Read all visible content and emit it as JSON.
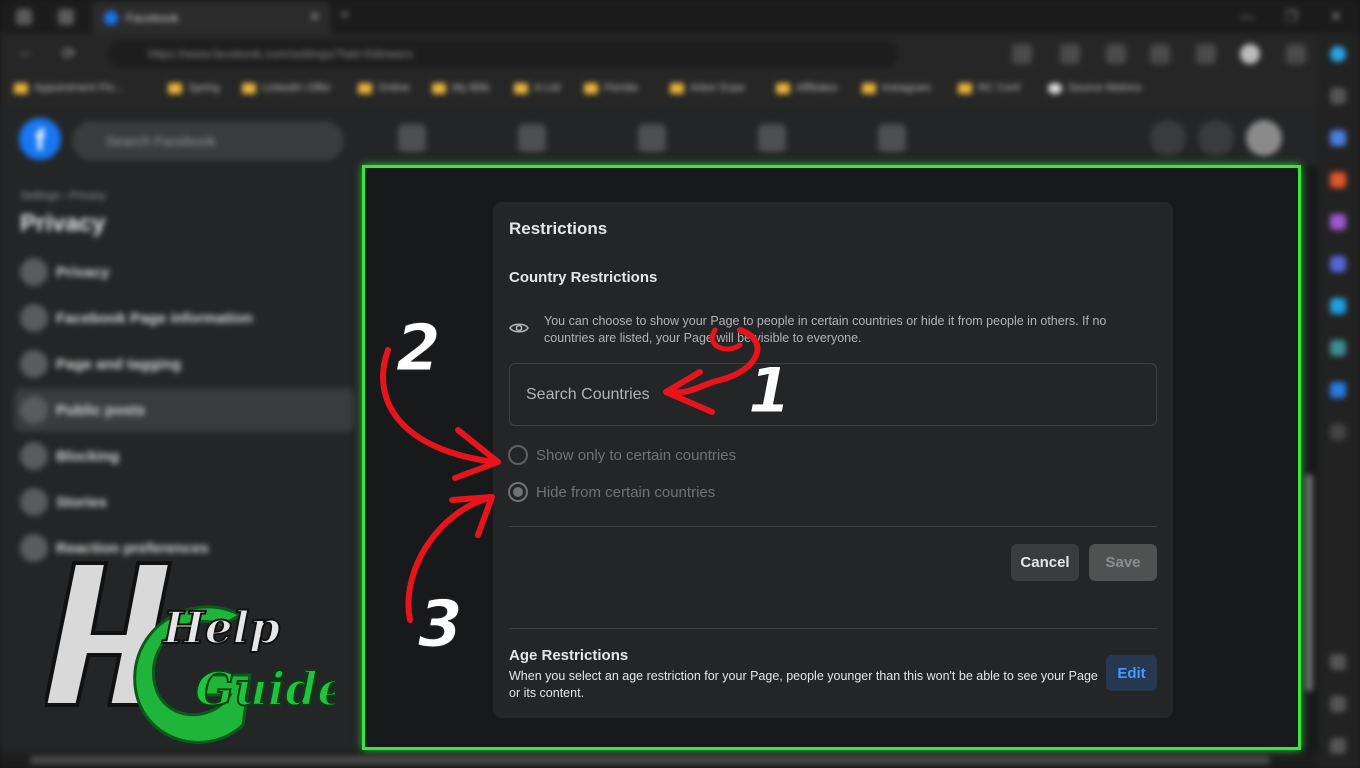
{
  "browser": {
    "tab_title": "Facebook",
    "url": "https://www.facebook.com/settings/?tab=followers",
    "bookmarks": [
      "Appointment Fin...",
      "Spring",
      "LinkedIn Offer",
      "Online",
      "My Bills",
      "A-Ltd",
      "Florida",
      "Arbor Expo",
      "Affiliates",
      "Instagram",
      "RC Conf",
      "Source Metrics"
    ]
  },
  "facebook": {
    "search_placeholder": "Search Facebook",
    "breadcrumb": "Settings › Privacy",
    "sidebar_title": "Privacy",
    "sidebar_items": [
      {
        "label": "Privacy"
      },
      {
        "label": "Facebook Page information"
      },
      {
        "label": "Page and tagging"
      },
      {
        "label": "Public posts"
      },
      {
        "label": "Blocking"
      },
      {
        "label": "Stories"
      },
      {
        "label": "Reaction preferences"
      }
    ]
  },
  "restrictions": {
    "title": "Restrictions",
    "country": {
      "title": "Country Restrictions",
      "info": "You can choose to show your Page to people in certain countries or hide it from people in others. If no countries are listed, your Page will be visible to everyone.",
      "search_placeholder": "Search Countries",
      "options": [
        {
          "label": "Show only to certain countries",
          "checked": false
        },
        {
          "label": "Hide from certain countries",
          "checked": true
        }
      ],
      "cancel_label": "Cancel",
      "save_label": "Save"
    },
    "age": {
      "title": "Age Restrictions",
      "text": "When you select an age restriction for your Page, people younger than this won't be able to see your Page or its content.",
      "edit_label": "Edit"
    }
  },
  "annotations": {
    "step1": "1",
    "step2": "2",
    "step3": "3",
    "arrow_color": "#e8141c",
    "highlight_color": "#39e639"
  },
  "watermark": {
    "text_top": "Help",
    "text_bottom": "Guider"
  }
}
